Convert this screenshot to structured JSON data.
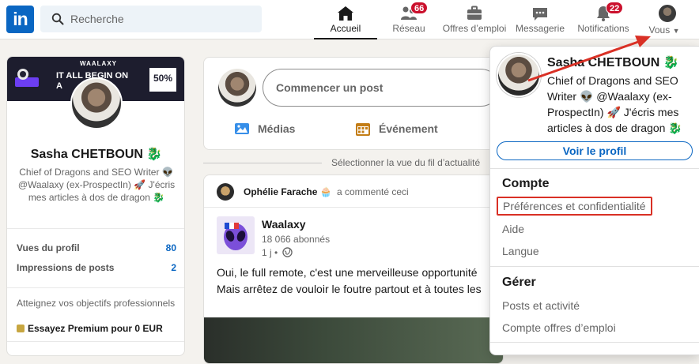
{
  "nav": {
    "search_placeholder": "Recherche",
    "items": [
      {
        "label": "Accueil",
        "icon": "home-icon",
        "active": true
      },
      {
        "label": "Réseau",
        "icon": "network-icon",
        "badge": "66"
      },
      {
        "label": "Offres d’emploi",
        "icon": "briefcase-icon"
      },
      {
        "label": "Messagerie",
        "icon": "message-icon"
      },
      {
        "label": "Notifications",
        "icon": "bell-icon",
        "badge": "22"
      },
      {
        "label": "Vous",
        "icon": "avatar"
      }
    ]
  },
  "profile_card": {
    "banner_brand": "WAALAXY",
    "banner_line1": "IT ALL BEGIN ON",
    "banner_line2": "A",
    "banner_promo": "50%",
    "name": "Sasha CHETBOUN 🐉",
    "headline": "Chief of Dragons and SEO Writer 👽 @Waalaxy (ex-ProspectIn) 🚀 J'écris mes articles à dos de dragon 🐉",
    "stats": [
      {
        "label": "Vues du profil",
        "value": "80"
      },
      {
        "label": "Impressions de posts",
        "value": "2"
      }
    ],
    "premium_text": "Atteignez vos objectifs professionnels",
    "premium_cta": "Essayez Premium pour 0 EUR"
  },
  "composer": {
    "placeholder": "Commencer un post",
    "actions": [
      {
        "label": "Médias",
        "icon": "image-icon",
        "color": "#378fe9"
      },
      {
        "label": "Événement",
        "icon": "calendar-icon",
        "color": "#c37d16"
      }
    ]
  },
  "feed_sort": "Sélectionner la vue du fil d’actualité",
  "post": {
    "actor": "Ophélie Farache",
    "actor_emoji": "🧁",
    "action": "a commenté ceci",
    "company": "Waalaxy",
    "followers": "18 066 abonnés",
    "time": "1 j •",
    "body": "Oui, le full remote, c'est une merveilleuse opportunité Mais arrêtez de vouloir le foutre partout et à toutes les"
  },
  "dropdown": {
    "name": "Sasha CHETBOUN 🐉",
    "headline": "Chief of Dragons and SEO Writer 👽 @Waalaxy (ex-ProspectIn) 🚀 J'écris mes articles à dos de dragon 🐉",
    "view_profile": "Voir le profil",
    "section_account": "Compte",
    "account_items": [
      "Préférences et confidentialité",
      "Aide",
      "Langue"
    ],
    "section_manage": "Gérer",
    "manage_items": [
      "Posts et activité",
      "Compte offres d’emploi"
    ]
  },
  "colors": {
    "brand": "#0a66c2",
    "badge": "#cb112d",
    "highlight": "#d93025"
  }
}
